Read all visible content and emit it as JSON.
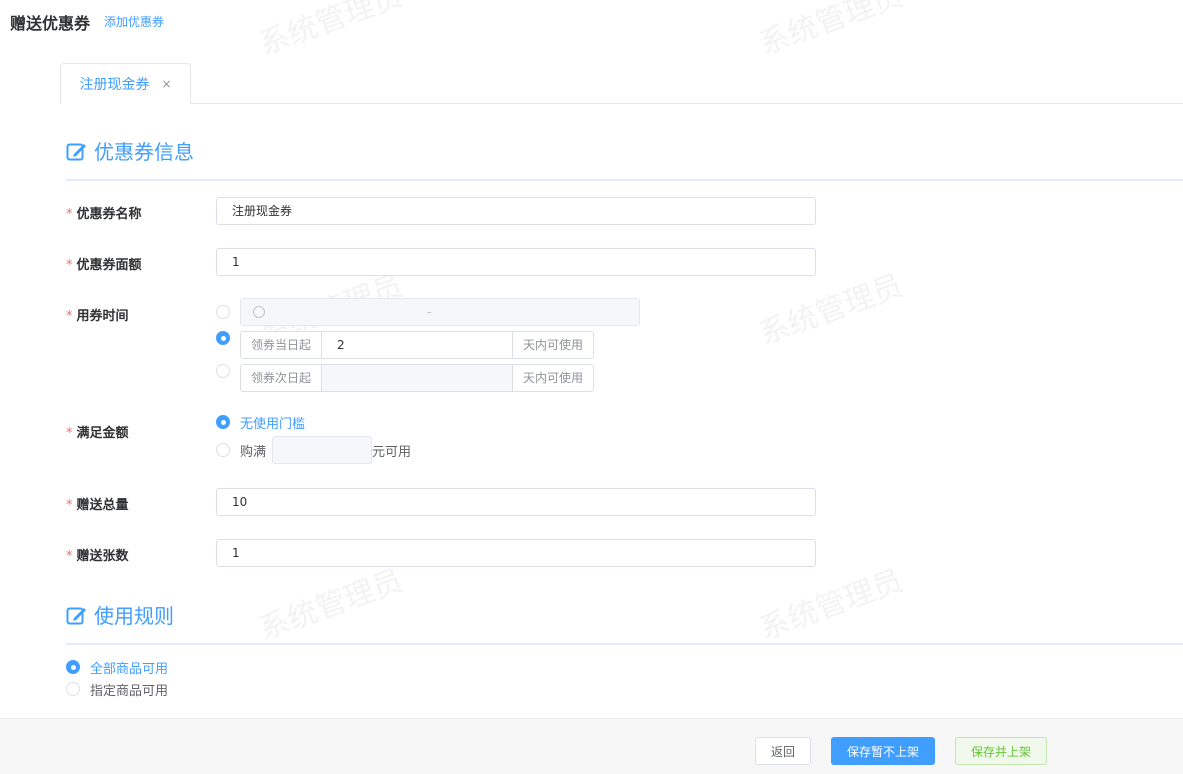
{
  "header": {
    "title": "赠送优惠券",
    "subtitle": "添加优惠券"
  },
  "tab": {
    "label": "注册现金券",
    "close": "×"
  },
  "sections": {
    "info": "优惠券信息",
    "rules": "使用规则"
  },
  "form": {
    "name": {
      "label": "优惠券名称",
      "value": "注册现金券"
    },
    "amount": {
      "label": "优惠券面额",
      "value": "1"
    },
    "time": {
      "label": "用券时间",
      "range_sep": "-",
      "opt2_prefix": "领券当日起",
      "opt2_value": "2",
      "opt2_suffix": "天内可使用",
      "opt3_prefix": "领券次日起",
      "opt3_value": "",
      "opt3_suffix": "天内可使用",
      "selected": 2
    },
    "threshold": {
      "label": "满足金额",
      "opt1": "无使用门槛",
      "opt2_prefix": "购满",
      "opt2_value": "",
      "opt2_suffix": "元可用",
      "selected": 1
    },
    "total": {
      "label": "赠送总量",
      "value": "10"
    },
    "per": {
      "label": "赠送张数",
      "value": "1"
    },
    "required_mark": "*"
  },
  "rules": {
    "opt1": "全部商品可用",
    "opt2": "指定商品可用",
    "selected": 1
  },
  "footer": {
    "back": "返回",
    "save_draft": "保存暂不上架",
    "save_publish": "保存并上架"
  },
  "watermark": "系统管理员",
  "colors": {
    "primary": "#409eff",
    "success": "#67c23a",
    "required": "#f56c6c"
  }
}
